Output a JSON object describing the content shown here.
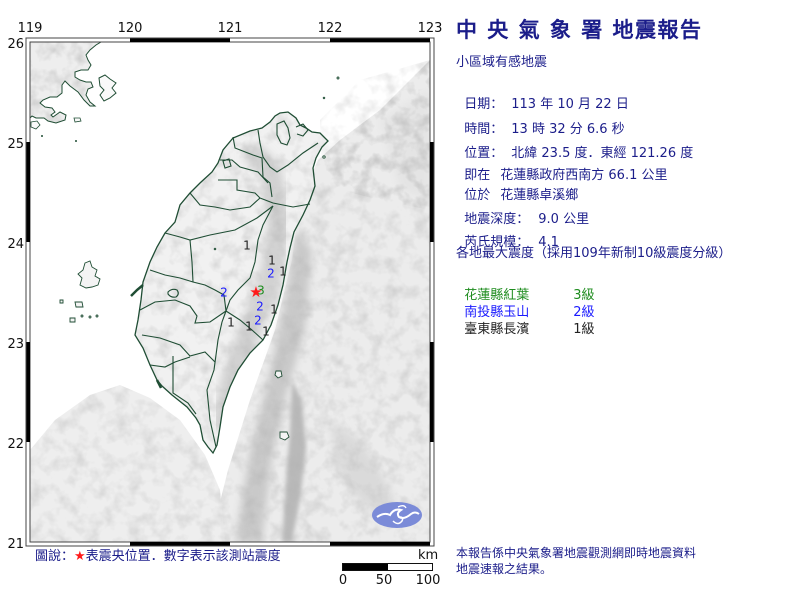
{
  "report": {
    "title": "中 央 氣 象 署 地震報告",
    "subtitle": "小區域有感地震",
    "date": {
      "label": "日期：",
      "value": "113 年 10 月 22 日"
    },
    "time": {
      "label": "時間：",
      "value": "13 時 32 分 6.6 秒"
    },
    "location": {
      "label": "位置：",
      "value": "北緯 23.5 度．東經 121.26 度"
    },
    "relative_location": {
      "label": "即在",
      "value": "花蓮縣政府西南方 66.1 公里"
    },
    "township": {
      "label": "位於",
      "value": "花蓮縣卓溪鄉"
    },
    "depth": {
      "label": "地震深度：",
      "value": "9.0 公里"
    },
    "magnitude": {
      "label": "芮氏規模：",
      "value": "4.1"
    },
    "max_intensity_heading": "各地最大震度（採用109年新制10級震度分級）",
    "max_intensity": [
      {
        "area": "花蓮縣紅葉",
        "grade": "3級",
        "color": "#1e8c1e"
      },
      {
        "area": "南投縣玉山",
        "grade": "2級",
        "color": "#1a1aff"
      },
      {
        "area": "臺東縣長濱",
        "grade": "1級",
        "color": "#222222"
      }
    ],
    "footnote": [
      "本報告係中央氣象署地震觀測網即時地震資料",
      "地震速報之結果。"
    ]
  },
  "map": {
    "extent": {
      "lon": [
        119,
        123
      ],
      "lat": [
        21,
        26
      ]
    },
    "lon_ticks": [
      "119",
      "120",
      "121",
      "122",
      "123"
    ],
    "lat_ticks": [
      "26",
      "25",
      "24",
      "23",
      "22",
      "21"
    ],
    "epicenter": {
      "lon": 121.26,
      "lat": 23.5,
      "symbol": "★",
      "color": "#ff1a1a"
    },
    "intensity_colors": {
      "1": "#222222",
      "2": "#1a1aff",
      "3": "#1e8c1e"
    },
    "stations": [
      {
        "intensity": "1",
        "lon": 121.17,
        "lat": 23.97
      },
      {
        "intensity": "1",
        "lon": 121.42,
        "lat": 23.82
      },
      {
        "intensity": "2",
        "lon": 121.41,
        "lat": 23.69
      },
      {
        "intensity": "1",
        "lon": 121.53,
        "lat": 23.71
      },
      {
        "intensity": "3",
        "lon": 121.31,
        "lat": 23.52
      },
      {
        "intensity": "2",
        "lon": 120.94,
        "lat": 23.5
      },
      {
        "intensity": "2",
        "lon": 121.3,
        "lat": 23.36
      },
      {
        "intensity": "1",
        "lon": 121.44,
        "lat": 23.33
      },
      {
        "intensity": "2",
        "lon": 121.28,
        "lat": 23.22
      },
      {
        "intensity": "1",
        "lon": 121.01,
        "lat": 23.2
      },
      {
        "intensity": "1",
        "lon": 121.19,
        "lat": 23.16
      },
      {
        "intensity": "1",
        "lon": 121.36,
        "lat": 23.11
      }
    ],
    "legend": {
      "prefix": "圖說：",
      "star": "★",
      "text": "表震央位置．數字表示該測站震度"
    },
    "scale": {
      "unit": "km",
      "labels": [
        "0",
        "50",
        "100"
      ]
    },
    "logo": "cwa-logo"
  }
}
